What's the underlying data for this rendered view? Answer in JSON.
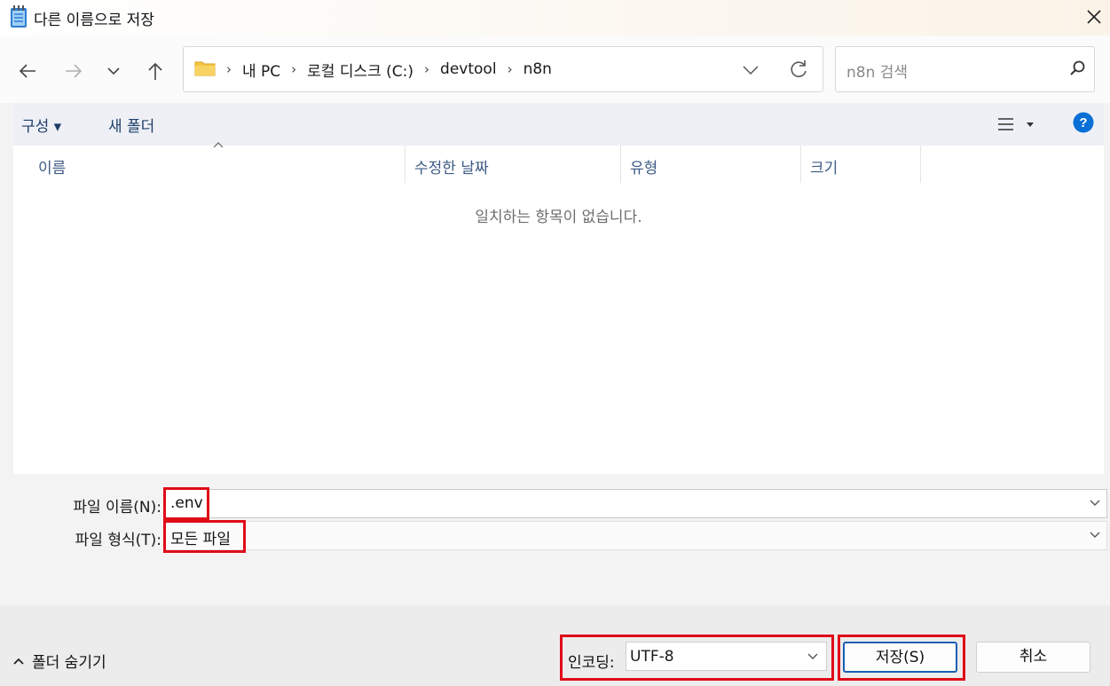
{
  "window": {
    "title": "다른 이름으로 저장"
  },
  "nav": {
    "breadcrumbs": [
      "내 PC",
      "로컬 디스크 (C:)",
      "devtool",
      "n8n"
    ],
    "search_placeholder": "n8n 검색"
  },
  "toolbar": {
    "organize_label": "구성 ▾",
    "new_folder_label": "새 폴더"
  },
  "filelist": {
    "columns": [
      "이름",
      "수정한 날짜",
      "유형",
      "크기"
    ],
    "empty_message": "일치하는 항목이 없습니다."
  },
  "form": {
    "filename_label": "파일 이름(N):",
    "filename_value": ".env",
    "filetype_label": "파일 형식(T):",
    "filetype_value": "모든 파일"
  },
  "footer": {
    "hide_folders_label": "폴더 숨기기",
    "encoding_label": "인코딩:",
    "encoding_value": "UTF-8",
    "save_label": "저장(S)",
    "cancel_label": "취소"
  },
  "colors": {
    "highlight_red": "#e00b18",
    "accent_blue": "#0a6fd6",
    "folder_yellow": "#f4c542"
  },
  "icons": [
    "notepad-icon",
    "close-icon",
    "back-arrow-icon",
    "forward-arrow-icon",
    "recent-dropdown-icon",
    "up-arrow-icon",
    "folder-icon",
    "chevron-right-icon",
    "chevron-down-icon",
    "refresh-icon",
    "search-icon",
    "view-options-icon",
    "help-icon",
    "caret-up-icon"
  ]
}
